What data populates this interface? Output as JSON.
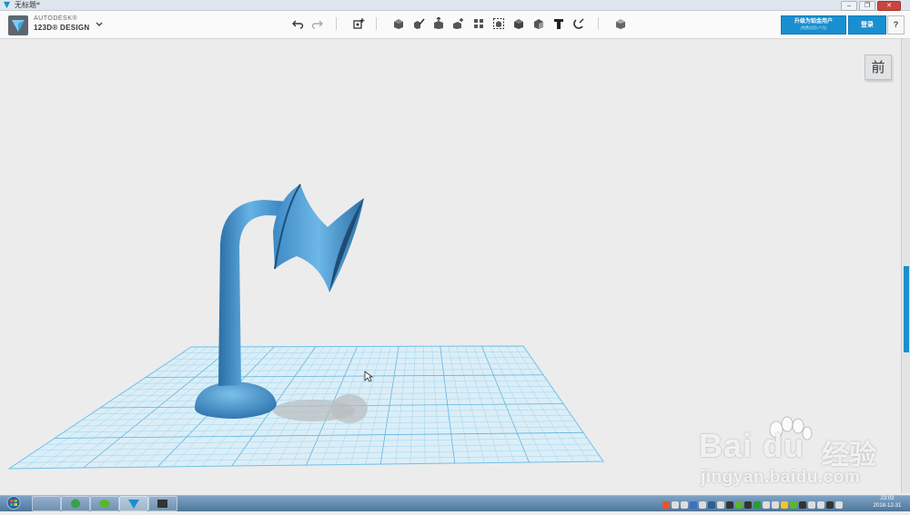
{
  "window": {
    "title": "无标题*",
    "controls": {
      "minimize": "–",
      "restore": "❐",
      "close": "✕"
    }
  },
  "brand": {
    "company": "AUTODESK®",
    "product": "123D® DESIGN"
  },
  "toolbar": {
    "tools": [
      {
        "name": "undo-icon",
        "glyph": "↶"
      },
      {
        "name": "redo-icon",
        "glyph": "↷"
      },
      {
        "name": "transform-icon",
        "glyph": ""
      },
      {
        "name": "primitives-icon",
        "glyph": ""
      },
      {
        "name": "sketch-icon",
        "glyph": ""
      },
      {
        "name": "construct-icon",
        "glyph": ""
      },
      {
        "name": "modify-icon",
        "glyph": ""
      },
      {
        "name": "pattern-icon",
        "glyph": ""
      },
      {
        "name": "grouping-icon",
        "glyph": ""
      },
      {
        "name": "combine-icon",
        "glyph": ""
      },
      {
        "name": "measure-icon",
        "glyph": ""
      },
      {
        "name": "text-icon",
        "glyph": "T"
      },
      {
        "name": "snap-icon",
        "glyph": ""
      },
      {
        "name": "material-icon",
        "glyph": ""
      }
    ]
  },
  "account": {
    "upgrade_label": "升级为铂金用户",
    "upgrade_sub": "(免费试用1个月)",
    "login_label": "登录",
    "help_label": "?"
  },
  "viewcube": {
    "face_label": "前"
  },
  "watermark": {
    "brand": "Bai du",
    "cn": "经验",
    "url": "jingyan.baidu.com"
  },
  "taskbar": {
    "time": "23:03",
    "date": "2018-12-31"
  },
  "colors": {
    "accent": "#1a8fd0",
    "model": "#3f8fc9",
    "grid": "#7cc3e6"
  }
}
